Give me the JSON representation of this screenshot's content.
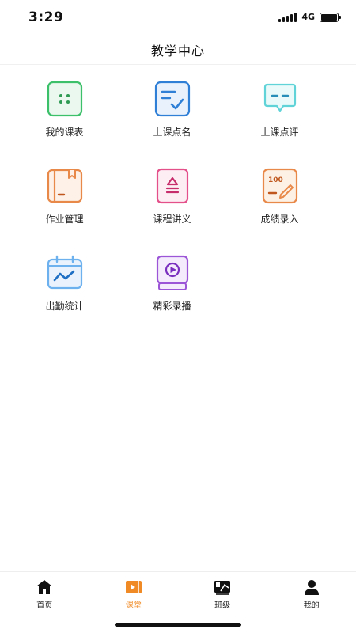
{
  "status": {
    "time": "3:29",
    "network": "4G"
  },
  "header": {
    "title": "教学中心"
  },
  "menu": [
    {
      "label": "我的课表",
      "icon": "schedule-icon",
      "color": "#3cc06a"
    },
    {
      "label": "上课点名",
      "icon": "checklist-icon",
      "color": "#2f7fd6"
    },
    {
      "label": "上课点评",
      "icon": "comment-icon",
      "color": "#5fd3d8"
    },
    {
      "label": "作业管理",
      "icon": "homework-book-icon",
      "color": "#e8894a"
    },
    {
      "label": "课程讲义",
      "icon": "handout-icon",
      "color": "#e3508a"
    },
    {
      "label": "成绩录入",
      "icon": "score-entry-icon",
      "color": "#e8894a",
      "badge": "100"
    },
    {
      "label": "出勤统计",
      "icon": "attendance-chart-icon",
      "color": "#3a8be0"
    },
    {
      "label": "精彩录播",
      "icon": "video-playback-icon",
      "color": "#9b55d6"
    }
  ],
  "tabs": [
    {
      "label": "首页",
      "icon": "home-icon",
      "active": false
    },
    {
      "label": "课堂",
      "icon": "classroom-icon",
      "active": true
    },
    {
      "label": "班级",
      "icon": "class-icon",
      "active": false
    },
    {
      "label": "我的",
      "icon": "profile-icon",
      "active": false
    }
  ],
  "colors": {
    "active_tab": "#f08a24",
    "text": "#222222"
  }
}
